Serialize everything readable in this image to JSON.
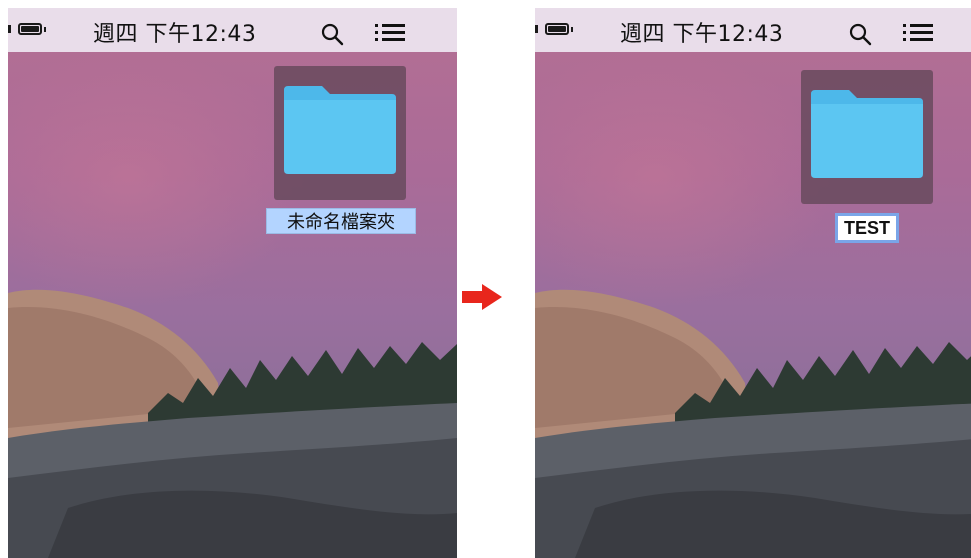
{
  "menubar": {
    "clock_text": "週四 下午12:43",
    "icons": [
      "battery-icon",
      "search-icon",
      "list-menu-icon"
    ]
  },
  "before": {
    "folder_label": "未命名檔案夾"
  },
  "after": {
    "folder_label": "TEST"
  },
  "colors": {
    "menubar_bg": "#e9ddea",
    "folder_blue": "#5cc6f2",
    "selection_blue": "#b3d4ff",
    "arrow_red": "#e8261c"
  }
}
